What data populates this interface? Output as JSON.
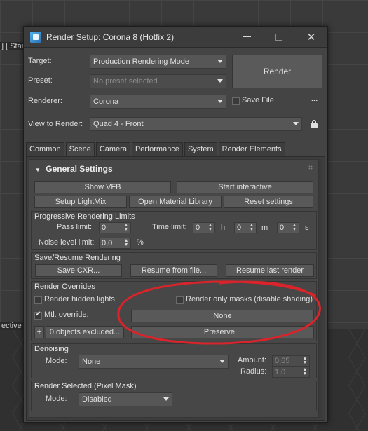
{
  "viewport": {
    "label_top": "] [ Stan",
    "label_mid": "ective ]"
  },
  "window": {
    "title": "Render Setup: Corona 8 (Hotfix 2)",
    "controls": {
      "minimize": "—",
      "maximize": "",
      "close": "✕"
    }
  },
  "header": {
    "target_label": "Target:",
    "target_value": "Production Rendering Mode",
    "preset_label": "Preset:",
    "preset_placeholder": "No preset selected",
    "renderer_label": "Renderer:",
    "renderer_value": "Corona",
    "save_file_label": "Save File",
    "save_file_checked": false,
    "ellipsis_label": "...",
    "view_label": "View to Render:",
    "view_value": "Quad 4 - Front",
    "render_button": "Render"
  },
  "tabs": [
    {
      "label": "Common",
      "active": false
    },
    {
      "label": "Scene",
      "active": true
    },
    {
      "label": "Camera",
      "active": false
    },
    {
      "label": "Performance",
      "active": false
    },
    {
      "label": "System",
      "active": false
    },
    {
      "label": "Render Elements",
      "active": false
    }
  ],
  "general_settings": {
    "title": "General Settings",
    "collapse_glyph": "▼",
    "buttons": {
      "show_vfb": "Show VFB",
      "start_interactive": "Start interactive",
      "setup_lightmix": "Setup LightMix",
      "open_material_library": "Open Material Library",
      "reset_settings": "Reset settings"
    }
  },
  "progressive": {
    "title": "Progressive Rendering Limits",
    "pass_limit_label": "Pass limit:",
    "pass_limit_value": "0",
    "time_limit_label": "Time limit:",
    "time_h_value": "0",
    "time_h_unit": "h",
    "time_m_value": "0",
    "time_m_unit": "m",
    "time_s_value": "0",
    "time_s_unit": "s",
    "noise_label": "Noise level limit:",
    "noise_value": "0,0",
    "noise_unit": "%"
  },
  "save_resume": {
    "title": "Save/Resume Rendering",
    "save_cxr": "Save CXR...",
    "resume_from_file": "Resume from file...",
    "resume_last": "Resume last render"
  },
  "render_overrides": {
    "title": "Render Overrides",
    "render_hidden_lights": "Render hidden lights",
    "render_hidden_lights_checked": false,
    "render_only_masks": "Render only masks (disable shading)",
    "render_only_masks_checked": false,
    "mtl_override": "Mtl. override:",
    "mtl_override_checked": true,
    "mtl_override_value": "None",
    "plus_label": "+",
    "objects_excluded": "0 objects excluded...",
    "preserve": "Preserve..."
  },
  "denoising": {
    "title": "Denoising",
    "mode_label": "Mode:",
    "mode_value": "None",
    "amount_label": "Amount:",
    "amount_value": "0,65",
    "radius_label": "Radius:",
    "radius_value": "1,0"
  },
  "render_selected": {
    "title": "Render Selected (Pixel Mask)",
    "mode_label": "Mode:",
    "mode_value": "Disabled"
  },
  "colors": {
    "annotation": "#d8242a",
    "window_bg": "#444444"
  }
}
